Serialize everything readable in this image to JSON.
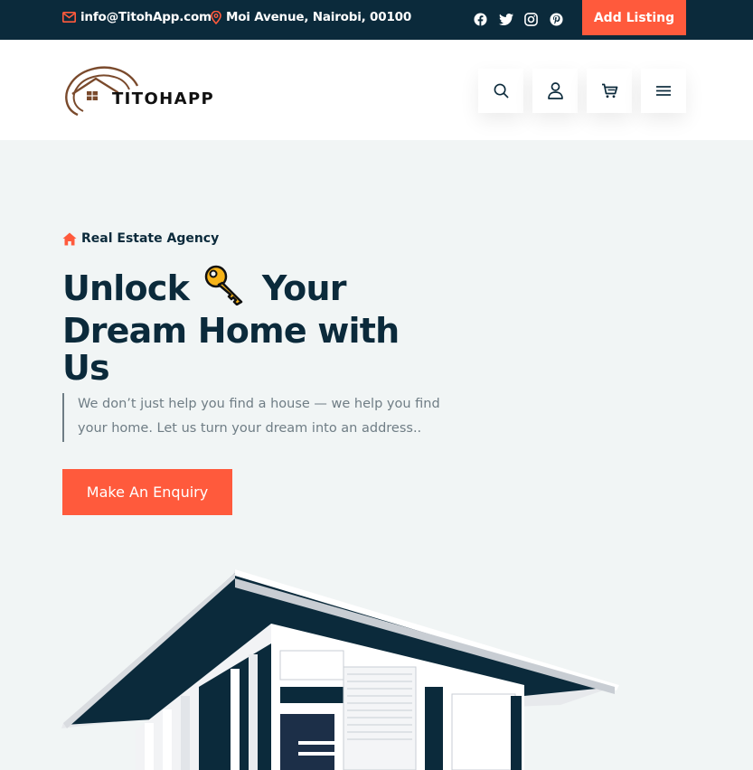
{
  "topbar": {
    "email": "info@TitohApp.com",
    "address": "Moi Avenue, Nairobi, 00100",
    "social_icons": [
      "facebook-icon",
      "twitter-icon",
      "instagram-icon",
      "pinterest-icon"
    ],
    "add_listing_label": "Add Listing"
  },
  "header": {
    "logo_text": "TITOHAPP",
    "icons": [
      "search-icon",
      "user-icon",
      "cart-icon",
      "menu-icon"
    ]
  },
  "hero": {
    "tagline": "Real Estate Agency",
    "headline_part1": "Unlock",
    "headline_part2": "Your Dream Home with Us",
    "description": "We don’t just help you find a house — we help you find your home. Let us turn your dream into an address..",
    "cta_label": "Make An Enquiry"
  },
  "colors": {
    "navy": "#0b2a3b",
    "accent": "#ff5a3c",
    "hero_bg": "#f1f5f5",
    "muted_text": "#6f7d85"
  }
}
